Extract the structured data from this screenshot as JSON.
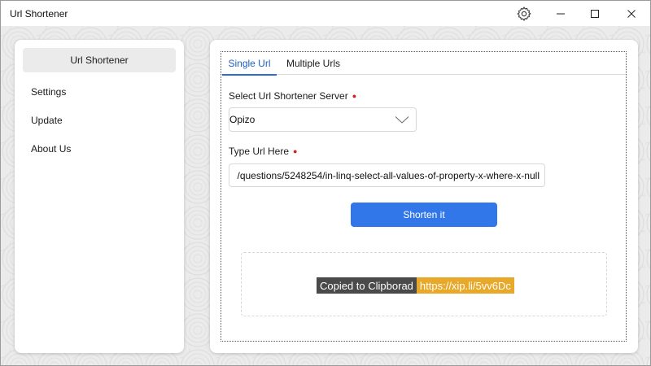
{
  "window": {
    "title": "Url Shortener",
    "controls": {
      "settings_icon": "gear-icon",
      "minimize_icon": "minimize-icon",
      "maximize_icon": "maximize-icon",
      "close_icon": "close-icon"
    }
  },
  "sidebar": {
    "items": [
      {
        "label": "Url Shortener",
        "active": true
      },
      {
        "label": "Settings",
        "active": false
      },
      {
        "label": "Update",
        "active": false
      },
      {
        "label": "About Us",
        "active": false
      }
    ]
  },
  "tabs": [
    {
      "label": "Single Url",
      "selected": true
    },
    {
      "label": "Multiple Urls",
      "selected": false
    }
  ],
  "form": {
    "server_label": "Select Url Shortener Server",
    "server_value": "Opizo",
    "url_label": "Type Url Here",
    "url_value": "/questions/5248254/in-linq-select-all-values-of-property-x-where-x-null",
    "required_marker": "●",
    "submit_label": "Shorten it"
  },
  "result": {
    "status": "Copied to Clipborad",
    "short_url": "https://xip.li/5vv6Dc"
  },
  "colors": {
    "accent": "#3277ea",
    "tab_accent": "#2f6bd6",
    "required": "#d42020",
    "status_bg": "#4a4a4a",
    "url_bg": "#e8a92a"
  }
}
